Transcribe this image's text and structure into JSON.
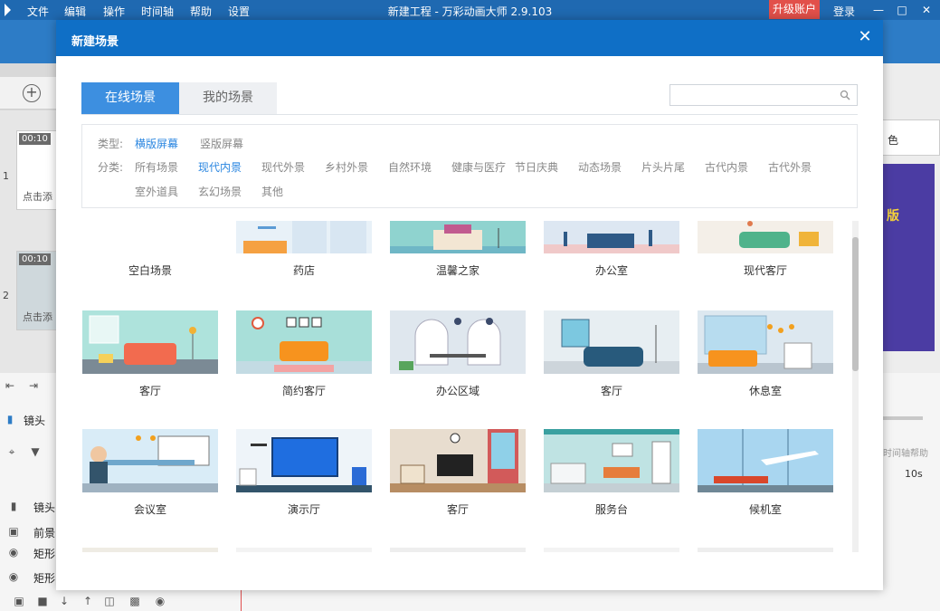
{
  "app": {
    "title": "新建工程 - 万彩动画大师 2.9.103",
    "menu": [
      "文件",
      "编辑",
      "操作",
      "时间轴",
      "帮助",
      "设置"
    ],
    "upgrade_label": "升级账户",
    "login_label": "登录",
    "window_controls": [
      "minimize-icon",
      "maximize-icon",
      "close-icon"
    ]
  },
  "background": {
    "scenes": [
      {
        "number": "1",
        "time": "00:10",
        "add_text": "点击添"
      },
      {
        "number": "2",
        "time": "00:10",
        "add_text": "点击添"
      }
    ],
    "tracks": [
      "镜头",
      "镜头",
      "前景",
      "矩形",
      "矩形"
    ],
    "right_button_label": "色",
    "preview_text": "版",
    "timeline_help": "时间轴帮助",
    "timeline_tick": "10s"
  },
  "modal": {
    "title": "新建场景",
    "close_icon": "close-icon",
    "tabs": [
      {
        "label": "在线场景",
        "active": true
      },
      {
        "label": "我的场景",
        "active": false
      }
    ],
    "search_placeholder": "",
    "filters": {
      "type_label": "类型:",
      "types": [
        {
          "label": "横版屏幕",
          "active": true
        },
        {
          "label": "竖版屏幕",
          "active": false
        }
      ],
      "category_label": "分类:",
      "categories_row1": [
        {
          "label": "所有场景",
          "active": false
        },
        {
          "label": "现代内景",
          "active": true
        },
        {
          "label": "现代外景",
          "active": false
        },
        {
          "label": "乡村外景",
          "active": false
        },
        {
          "label": "自然环境",
          "active": false
        },
        {
          "label": "健康与医疗",
          "active": false
        },
        {
          "label": "节日庆典",
          "active": false
        },
        {
          "label": "动态场景",
          "active": false
        },
        {
          "label": "片头片尾",
          "active": false
        },
        {
          "label": "古代内景",
          "active": false
        },
        {
          "label": "古代外景",
          "active": false
        }
      ],
      "categories_row2": [
        {
          "label": "室外道具",
          "active": false
        },
        {
          "label": "玄幻场景",
          "active": false
        },
        {
          "label": "其他",
          "active": false
        }
      ]
    },
    "scenes_row1": [
      {
        "label": "空白场景"
      },
      {
        "label": "药店"
      },
      {
        "label": "温馨之家"
      },
      {
        "label": "办公室"
      },
      {
        "label": "现代客厅"
      }
    ],
    "scenes_row2": [
      {
        "label": "客厅"
      },
      {
        "label": "简约客厅"
      },
      {
        "label": "办公区域"
      },
      {
        "label": "客厅"
      },
      {
        "label": "休息室"
      }
    ],
    "scenes_row3": [
      {
        "label": "会议室"
      },
      {
        "label": "演示厅"
      },
      {
        "label": "客厅"
      },
      {
        "label": "服务台"
      },
      {
        "label": "候机室"
      }
    ]
  },
  "colors": {
    "header_blue": "#0f6fc6",
    "tab_active": "#3d8fe0",
    "filter_active": "#2a86e0",
    "upgrade_red": "#e2504a"
  }
}
